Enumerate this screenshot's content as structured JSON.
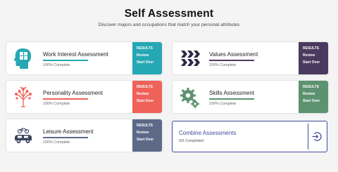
{
  "page": {
    "title": "Self Assessment",
    "subtitle": "Discover majors and occupations that match your personal attributes"
  },
  "panel_labels": {
    "results": "RESULTS",
    "review": "Review",
    "start_over": "Start Over"
  },
  "cards": {
    "work_interest": {
      "name": "Work Interest Assessment",
      "status": "100% Complete",
      "completion": 1.0,
      "color": "#25a8b4",
      "icon": "head-puzzle-icon"
    },
    "values": {
      "name": "Values Assessment",
      "status": "100% Complete",
      "completion": 1.0,
      "color": "#4b3a5f",
      "icon": "chevrons-icon"
    },
    "personality": {
      "name": "Personality Assessment",
      "status": "100% Complete",
      "completion": 1.0,
      "color": "#ef6259",
      "icon": "tree-icon"
    },
    "skills": {
      "name": "Skills Assessment",
      "status": "100% Complete",
      "completion": 1.0,
      "color": "#5c9270",
      "icon": "gears-icon"
    },
    "leisure": {
      "name": "Leisure Assessment",
      "status": "100% Complete",
      "completion": 1.0,
      "color": "#5c6a88",
      "icon": "car-bikes-icon"
    }
  },
  "combine": {
    "name": "Combine Assessments",
    "status": "5/5 Completed",
    "color": "#3f4a9c",
    "icon": "enter-circle-icon"
  }
}
